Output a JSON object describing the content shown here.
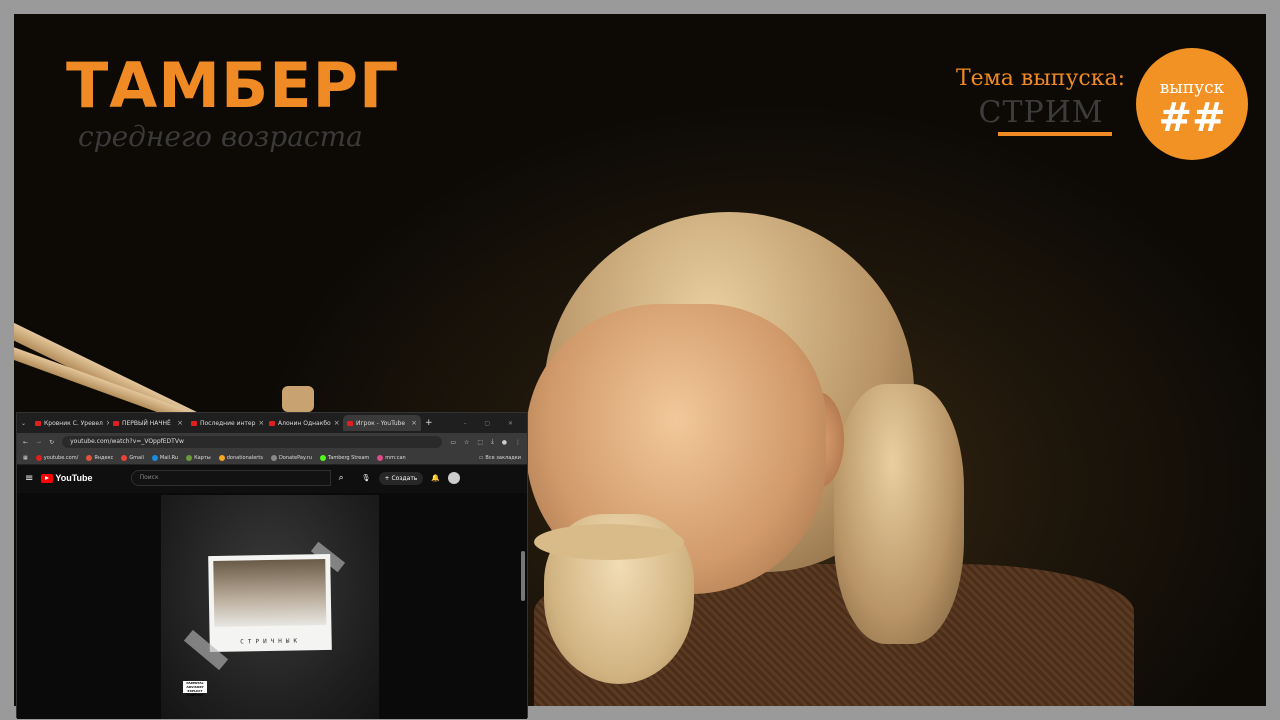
{
  "overlay": {
    "brand_title": "ТАМБЕРГ",
    "brand_subtitle": "среднего возраста",
    "topic_label": "Тема выпуска:",
    "topic_value": "СТРИМ",
    "badge_label": "выпуск",
    "badge_number": "##",
    "accent_color": "#f08a24"
  },
  "browser": {
    "tabs": [
      {
        "label": "Кровник С. Уревел",
        "active": false
      },
      {
        "label": "ПЕРВЫЙ НАЧНЁ",
        "active": false
      },
      {
        "label": "Последние интер",
        "active": false
      },
      {
        "label": "Алонин Однакбо",
        "active": false
      },
      {
        "label": "Игрок - YouTube",
        "active": true
      }
    ],
    "url": "youtube.com/watch?v=_VOppfEDTVw",
    "bookmarks": [
      {
        "label": "youtube.com/",
        "color": "#e02020"
      },
      {
        "label": "Яндекс",
        "color": "#e0543a"
      },
      {
        "label": "Gmail",
        "color": "#ea4335"
      },
      {
        "label": "Mail.Ru",
        "color": "#168de2"
      },
      {
        "label": "Карты",
        "color": "#6a9a3a"
      },
      {
        "label": "donationalerts",
        "color": "#f5a623"
      },
      {
        "label": "DonatePay.ru",
        "color": "#888888"
      },
      {
        "label": "Tamberg Stream",
        "color": "#53fc18"
      },
      {
        "label": "mm:can",
        "color": "#e04a8a"
      }
    ],
    "bookmarks_all": "Все закладки",
    "youtube": {
      "logo": "YouTube",
      "search_placeholder": "Поиск",
      "create_label": "Создать"
    },
    "video": {
      "cover_caption": "СТРИЧНЫК",
      "advisory": "PARENTAL ADVISORY EXPLICIT CONTENT"
    }
  }
}
